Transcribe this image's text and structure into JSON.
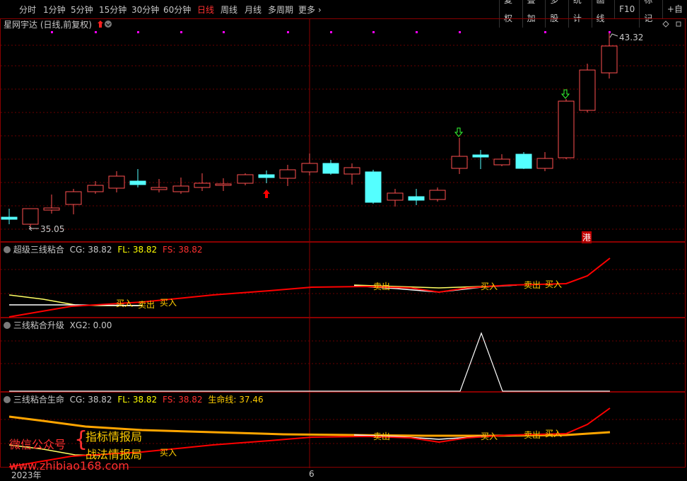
{
  "toolbar": {
    "periods": [
      "分时",
      "1分钟",
      "5分钟",
      "15分钟",
      "30分钟",
      "60分钟",
      "日线",
      "周线",
      "月线",
      "多周期",
      "更多 ›"
    ],
    "active_period": "日线",
    "right_buttons": [
      "复权",
      "叠加",
      "多股",
      "统计",
      "画线",
      "F10",
      "标记",
      "+自"
    ]
  },
  "main": {
    "title": "星网宇达 (日线,前复权)",
    "high_label": "43.32",
    "low_label": "35.05",
    "hk_badge": "港"
  },
  "pane1": {
    "name": "超级三线粘合",
    "cg_label": "CG: 38.82",
    "fl_label": "FL: 38.82",
    "fs_label": "FS: 38.82",
    "signals": [
      "买入",
      "卖出",
      "买入",
      "卖出",
      "买入",
      "卖出",
      "买入"
    ]
  },
  "pane2": {
    "name": "三线粘合升级",
    "xg_label": "XG2: 0.00"
  },
  "pane3": {
    "name": "三线粘合生命",
    "cg_label": "CG: 38.82",
    "fl_label": "FL: 38.82",
    "fs_label": "FS: 38.82",
    "life_label": "生命线: 37.46",
    "signals": [
      "卖出",
      "买入",
      "卖出",
      "买入",
      "买入"
    ]
  },
  "watermark": {
    "wechat": "微信公众号",
    "line1": "指标情报局",
    "line2": "战法情报局",
    "url": "www.zhibiao168.com"
  },
  "axis": {
    "year": "2023年",
    "month": "6"
  },
  "colors": {
    "up": "#ff5050",
    "down": "#54ffff",
    "red_line": "#ff0000",
    "yellow_line": "#ffff64",
    "white_line": "#ffffff",
    "orange_line": "#ffa500",
    "fl_label": "#ffff00",
    "fs_label": "#ff3030"
  }
}
